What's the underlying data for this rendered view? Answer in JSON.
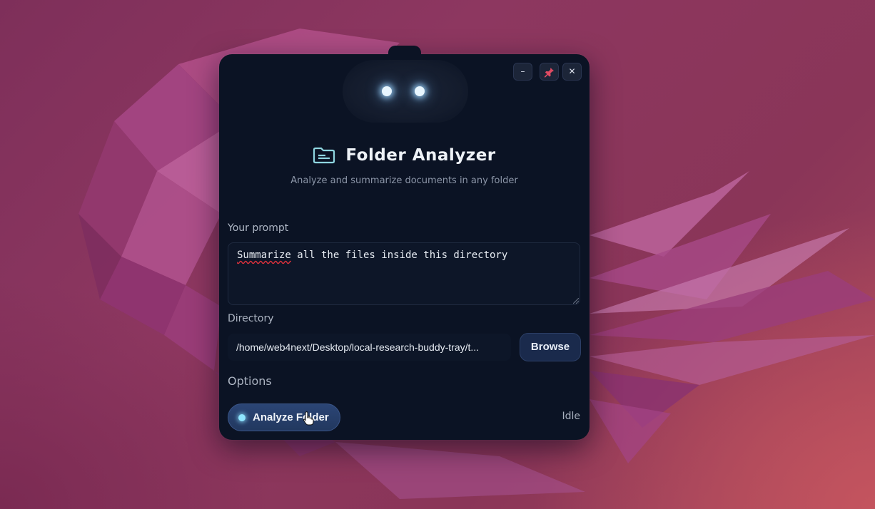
{
  "window": {
    "minimize_glyph": "–",
    "close_glyph": "✕"
  },
  "header": {
    "title": "Folder Analyzer",
    "subtitle": "Analyze and summarize documents in any folder",
    "icon": "folder-icon"
  },
  "prompt": {
    "label": "Your prompt",
    "value_prefix": "",
    "misspelled_word": "Summarize",
    "value_rest": " all the files inside this directory"
  },
  "directory": {
    "label": "Directory",
    "value": "/home/web4next/Desktop/local-research-buddy-tray/t...",
    "browse_label": "Browse"
  },
  "options": {
    "label": "Options"
  },
  "actions": {
    "analyze_label": "Analyze Folder",
    "status": "Idle"
  },
  "colors": {
    "panel": "#0b1324",
    "accent": "#8fe6ff",
    "button": "#22385f",
    "wallpaper": "#8a3558"
  }
}
